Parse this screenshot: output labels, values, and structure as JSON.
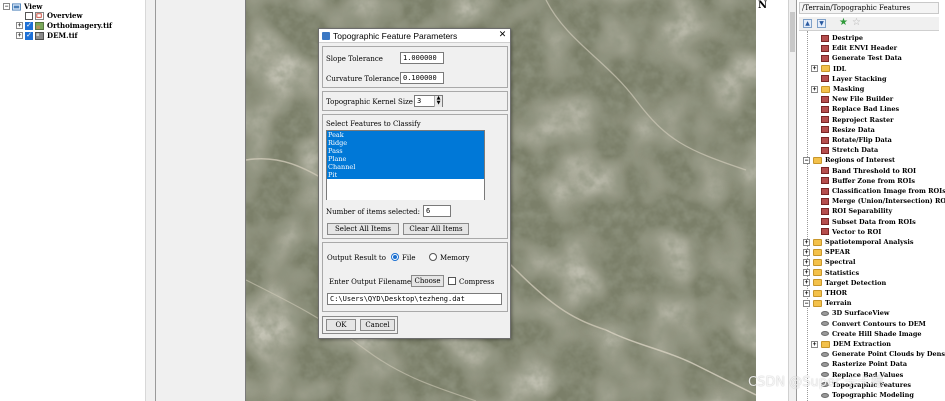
{
  "layer_tree": {
    "root": "View",
    "items": [
      {
        "label": "Overview",
        "checked": false
      },
      {
        "label": "Orthoimagery.tif",
        "checked": true
      },
      {
        "label": "DEM.tif",
        "checked": true
      }
    ]
  },
  "map": {
    "north_label": "N"
  },
  "dialog": {
    "title": "Topographic Feature Parameters",
    "close_glyph": "✕",
    "slope_label": "Slope Tolerance",
    "slope_value": "1.000000",
    "curvature_label": "Curvature Tolerance",
    "curvature_value": "0.100000",
    "kernel_label": "Topographic Kernel Size",
    "kernel_value": "3",
    "features_label": "Select Features to Classify",
    "features": [
      "Peak",
      "Ridge",
      "Pass",
      "Plane",
      "Channel",
      "Pit"
    ],
    "count_label": "Number of items selected:",
    "count_value": "6",
    "select_all_label": "Select All Items",
    "clear_all_label": "Clear All Items",
    "output_label": "Output Result to",
    "file_label": "File",
    "memory_label": "Memory",
    "output_selected": "File",
    "filename_label": "Enter Output Filename",
    "choose_label": "Choose",
    "compress_label": "Compress",
    "compress_checked": false,
    "filename_value": "C:\\Users\\QYD\\Desktop\\tezheng.dat",
    "ok_label": "OK",
    "cancel_label": "Cancel"
  },
  "toolbox": {
    "path": "/Terrain/Topographic Features",
    "rows": [
      {
        "label": "Destripe",
        "kind": "tool",
        "indent": 2
      },
      {
        "label": "Edit ENVI Header",
        "kind": "tool",
        "indent": 2
      },
      {
        "label": "Generate Test Data",
        "kind": "tool",
        "indent": 2
      },
      {
        "label": "IDL",
        "kind": "folder",
        "indent": 1,
        "expander": "+"
      },
      {
        "label": "Layer Stacking",
        "kind": "tool",
        "indent": 2
      },
      {
        "label": "Masking",
        "kind": "folder",
        "indent": 1,
        "expander": "+"
      },
      {
        "label": "New File Builder",
        "kind": "tool",
        "indent": 2
      },
      {
        "label": "Replace Bad Lines",
        "kind": "tool",
        "indent": 2
      },
      {
        "label": "Reproject Raster",
        "kind": "tool",
        "indent": 2
      },
      {
        "label": "Resize Data",
        "kind": "tool",
        "indent": 2
      },
      {
        "label": "Rotate/Flip Data",
        "kind": "tool",
        "indent": 2
      },
      {
        "label": "Stretch Data",
        "kind": "tool",
        "indent": 2
      },
      {
        "label": "Regions of Interest",
        "kind": "folder",
        "indent": 0,
        "expander": "−"
      },
      {
        "label": "Band Threshold to ROI",
        "kind": "tool",
        "indent": 2
      },
      {
        "label": "Buffer Zone from ROIs",
        "kind": "tool",
        "indent": 2
      },
      {
        "label": "Classification Image from ROIs",
        "kind": "tool",
        "indent": 2
      },
      {
        "label": "Merge (Union/Intersection) ROIs",
        "kind": "tool",
        "indent": 2
      },
      {
        "label": "ROI Separability",
        "kind": "tool",
        "indent": 2
      },
      {
        "label": "Subset Data from ROIs",
        "kind": "tool",
        "indent": 2
      },
      {
        "label": "Vector to ROI",
        "kind": "tool",
        "indent": 2
      },
      {
        "label": "Spatiotemporal Analysis",
        "kind": "folder",
        "indent": 0,
        "expander": "+"
      },
      {
        "label": "SPEAR",
        "kind": "folder",
        "indent": 0,
        "expander": "+"
      },
      {
        "label": "Spectral",
        "kind": "folder",
        "indent": 0,
        "expander": "+"
      },
      {
        "label": "Statistics",
        "kind": "folder",
        "indent": 0,
        "expander": "+"
      },
      {
        "label": "Target Detection",
        "kind": "folder",
        "indent": 0,
        "expander": "+"
      },
      {
        "label": "THOR",
        "kind": "folder",
        "indent": 0,
        "expander": "+"
      },
      {
        "label": "Terrain",
        "kind": "folder",
        "indent": 0,
        "expander": "−"
      },
      {
        "label": "3D SurfaceView",
        "kind": "ellipse",
        "indent": 2
      },
      {
        "label": "Convert Contours to DEM",
        "kind": "ellipse",
        "indent": 2
      },
      {
        "label": "Create Hill Shade Image",
        "kind": "ellipse",
        "indent": 2
      },
      {
        "label": "DEM Extraction",
        "kind": "folder",
        "indent": 1,
        "expander": "+"
      },
      {
        "label": "Generate Point Clouds by Dense",
        "kind": "ellipse",
        "indent": 2
      },
      {
        "label": "Rasterize Point Data",
        "kind": "ellipse",
        "indent": 2
      },
      {
        "label": "Replace Bad Values",
        "kind": "ellipse",
        "indent": 2
      },
      {
        "label": "Topographic Features",
        "kind": "ellipse",
        "indent": 2
      },
      {
        "label": "Topographic Modeling",
        "kind": "ellipse",
        "indent": 2
      }
    ]
  },
  "watermark": "CSDN @Super 卡卡穗",
  "colors": {
    "selection": "#0078d7",
    "dialog_bg": "#f0f0f0",
    "folder": "#f3c14b",
    "map_base": "#6f7560"
  }
}
